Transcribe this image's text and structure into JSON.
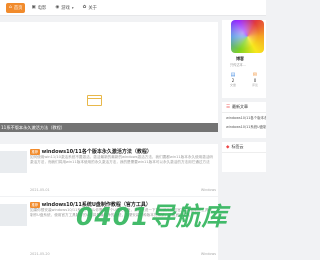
{
  "header": {
    "nav": [
      {
        "label": "首页",
        "icon": "home-icon",
        "active": true
      },
      {
        "label": "电影",
        "icon": "film-icon"
      },
      {
        "label": "游戏",
        "icon": "gamepad-icon",
        "dropdown": true
      },
      {
        "label": "关于",
        "icon": "info-icon"
      }
    ]
  },
  "featured": {
    "caption": "11系不版本永久激活方法（教程）"
  },
  "posts": [
    {
      "badge": "推荐",
      "title": "windows10/11各个版本永久激活方法（教程）",
      "excerpt": "如何使用win11/10激活系统不要激活，激活最新的最新的windows激活方法，我们要都win11版本永久使用激活码激活方法，而我们将用win11版本使用的永久激活方法，我的是需要win11版本可以永久激活的方法用它通过方法",
      "date": "2021-05-01",
      "views": "阅读",
      "category": "Windows"
    },
    {
      "badge": "推荐",
      "title": "windows10/11系统U盘制作教程（官方工具）",
      "excerpt": "如果你想安装windows10/11系统，那么你需要一个U盘安装盘，我们来说一下如何使用微软官方的U盘制作工具来制作U盘系统，使用官方工具制作的U盘将是最纯净的系统，方便安装各种版本的系统，下载官方工具",
      "date": "2021-05-20",
      "views": "阅读",
      "category": "Windows"
    }
  ],
  "sidebar": {
    "profile": {
      "name": "博客",
      "desc": "只传达本...",
      "stats": [
        {
          "icon": "post-icon",
          "value": "2",
          "label": "文章"
        },
        {
          "icon": "comment-icon",
          "value": "0",
          "label": "评论"
        }
      ]
    },
    "latest": {
      "title": "最新文章",
      "items": [
        "windows10/11各个版本永久激活",
        "windows10/11系统U盘制作"
      ]
    },
    "tags": {
      "title": "标签云"
    }
  },
  "watermark": "0401导航库"
}
